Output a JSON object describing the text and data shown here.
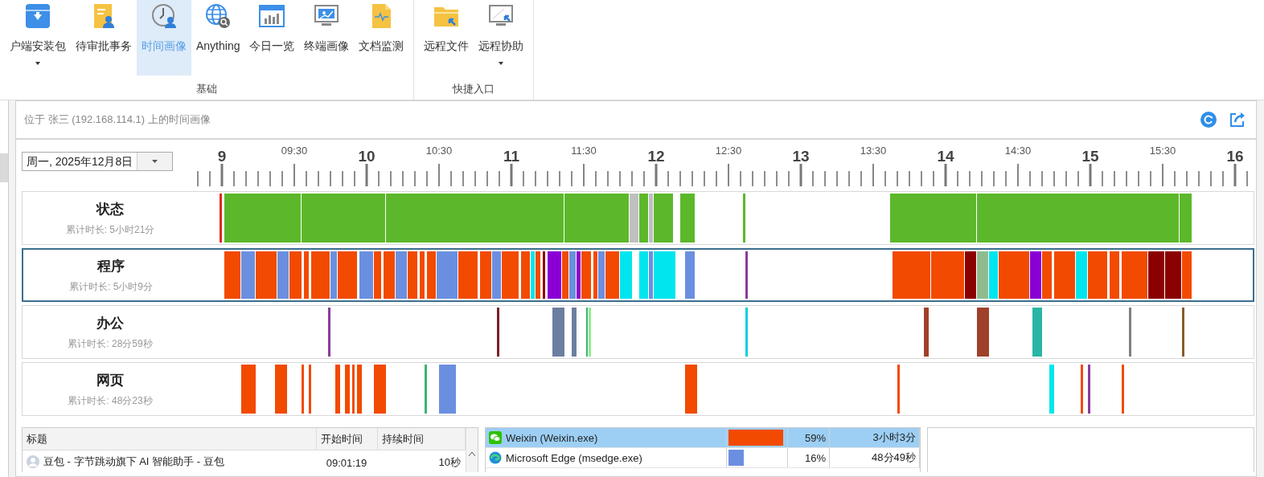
{
  "ribbon": {
    "groups": [
      {
        "label": "基础",
        "items": [
          {
            "label": "户端安装包",
            "has_menu": true,
            "selected": false
          },
          {
            "label": "待审批事务",
            "has_menu": false,
            "selected": false
          },
          {
            "label": "时间画像",
            "has_menu": false,
            "selected": true
          },
          {
            "label": "Anything",
            "has_menu": false,
            "selected": false
          },
          {
            "label": "今日一览",
            "has_menu": false,
            "selected": false
          },
          {
            "label": "终端画像",
            "has_menu": false,
            "selected": false
          },
          {
            "label": "文档监测",
            "has_menu": false,
            "selected": false
          }
        ]
      },
      {
        "label": "快捷入口",
        "items": [
          {
            "label": "远程文件",
            "has_menu": false,
            "selected": false
          },
          {
            "label": "远程协助",
            "has_menu": true,
            "selected": false
          }
        ]
      }
    ]
  },
  "header": {
    "title": "位于 张三 (192.168.114.1) 上的时间画像"
  },
  "date_picker": {
    "value": "周一, 2025年12月8日"
  },
  "axis": {
    "hour_labels": [
      "9",
      "10",
      "11",
      "12",
      "13",
      "14",
      "15",
      "16"
    ],
    "half_hour_labels": [
      "09:30",
      "10:30",
      "11:30",
      "12:30",
      "13:30",
      "14:30",
      "15:30"
    ]
  },
  "tracks": [
    {
      "title": "状态",
      "total": "累计时长: 5小时21分",
      "selected": false
    },
    {
      "title": "程序",
      "total": "累计时长: 5小时9分",
      "selected": true
    },
    {
      "title": "办公",
      "total": "累计时长: 28分59秒",
      "selected": false
    },
    {
      "title": "网页",
      "total": "累计时长: 48分23秒",
      "selected": false
    }
  ],
  "usage_table": {
    "columns": [
      "标题",
      "开始时间",
      "持续时间"
    ],
    "rows": [
      {
        "title": "豆包 - 字节跳动旗下 AI 智能助手 - 豆包",
        "start": "09:01:19",
        "duration": "10秒"
      }
    ]
  },
  "app_list": [
    {
      "name": "Weixin (Weixin.exe)",
      "level": 0.96,
      "color": "#f24a00",
      "percent": "59%",
      "duration": "3小时3分",
      "selected": true
    },
    {
      "name": "Microsoft Edge (msedge.exe)",
      "level": 0.27,
      "color": "#6b8fe0",
      "percent": "16%",
      "duration": "48分49秒",
      "selected": false
    }
  ]
}
